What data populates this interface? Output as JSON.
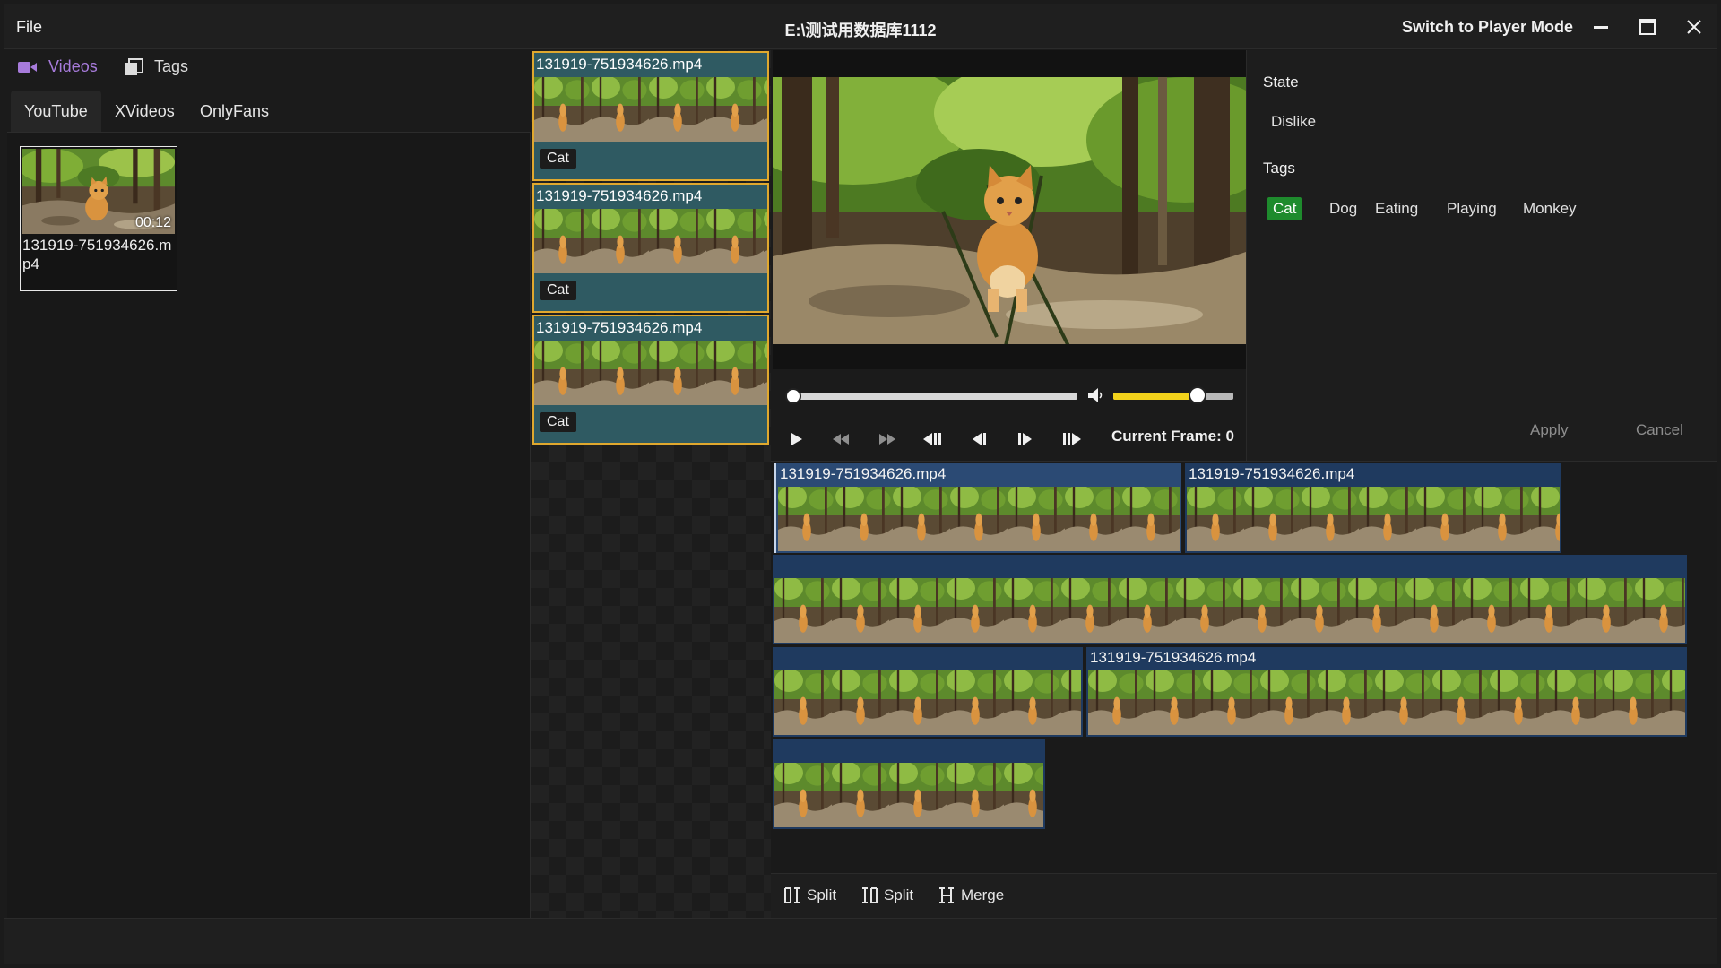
{
  "titlebar": {
    "menu_file": "File",
    "title": "E:\\测试用数据库1112",
    "switch_mode": "Switch to Player Mode"
  },
  "sidebar": {
    "nav": [
      {
        "label": "Videos",
        "icon": "video-camera-icon",
        "active": true
      },
      {
        "label": "Tags",
        "icon": "tags-stack-icon",
        "active": false
      }
    ],
    "category_tabs": [
      {
        "label": "YouTube",
        "active": true
      },
      {
        "label": "XVideos",
        "active": false
      },
      {
        "label": "OnlyFans",
        "active": false
      }
    ],
    "videos": [
      {
        "filename": "131919-751934626.mp4",
        "duration": "00:12"
      }
    ]
  },
  "clips": [
    {
      "filename": "131919-751934626.mp4",
      "tag": "Cat"
    },
    {
      "filename": "131919-751934626.mp4",
      "tag": "Cat"
    },
    {
      "filename": "131919-751934626.mp4",
      "tag": "Cat"
    }
  ],
  "player": {
    "seek_fraction": 0.0,
    "volume_fraction": 0.7,
    "current_frame_label": "Current Frame: 0",
    "controls": [
      "play-icon",
      "rewind-icon",
      "fast-forward-icon",
      "first-frame-icon",
      "previous-frame-icon",
      "next-frame-icon",
      "last-frame-icon"
    ]
  },
  "info": {
    "state_heading": "State",
    "state_value": "Dislike",
    "tags_heading": "Tags",
    "tags": [
      {
        "label": "Cat",
        "active": true
      },
      {
        "label": "Dog",
        "active": false
      },
      {
        "label": "Eating",
        "active": false
      },
      {
        "label": "Playing",
        "active": false
      },
      {
        "label": "Monkey",
        "active": false
      }
    ],
    "apply_label": "Apply",
    "cancel_label": "Cancel"
  },
  "timeline": {
    "segments": [
      {
        "label": "131919-751934626.mp4",
        "selected": true
      },
      {
        "label": "131919-751934626.mp4",
        "selected": false
      },
      {
        "label": "",
        "selected": false
      },
      {
        "label": "",
        "selected": false
      },
      {
        "label": "131919-751934626.mp4",
        "selected": false
      },
      {
        "label": "",
        "selected": false
      }
    ]
  },
  "toolbar": {
    "split_left_label": "Split",
    "split_right_label": "Split",
    "merge_label": "Merge"
  },
  "colors": {
    "accent_purple": "#a77bdb",
    "clip_border": "#e0a82e",
    "clip_bg": "#2f5a62",
    "tag_active": "#1e8b2d",
    "volume_fill": "#f2d21b",
    "timeline_segment": "#1f3a5f"
  }
}
